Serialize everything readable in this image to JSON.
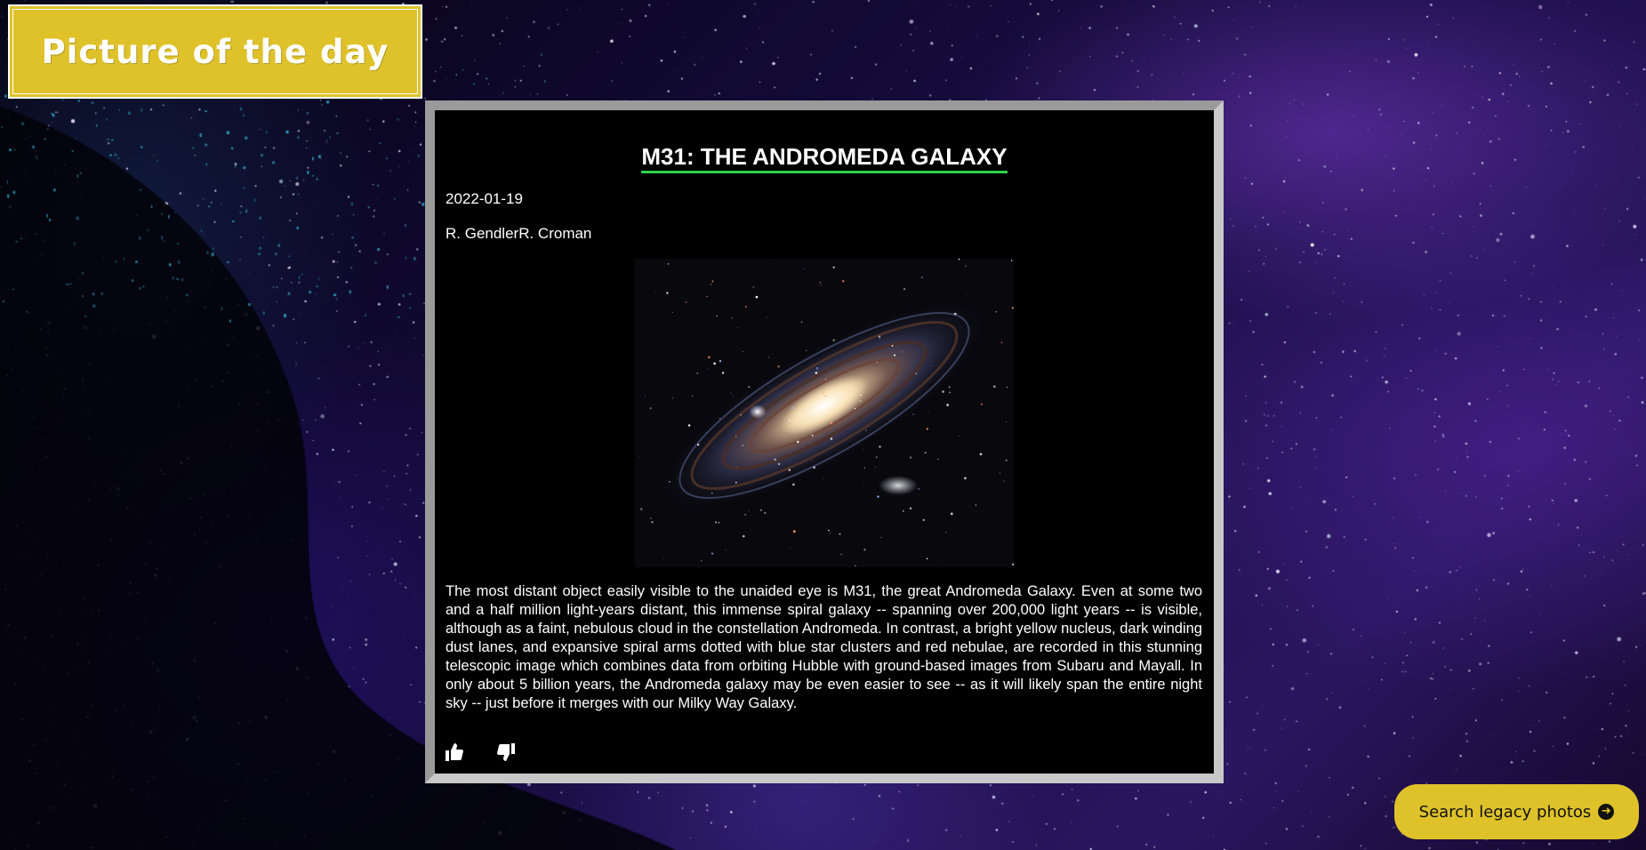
{
  "header": {
    "title": "Picture of the day"
  },
  "apod": {
    "title": "M31: THE ANDROMEDA GALAXY",
    "date": "2022-01-19",
    "copyright": "R. GendlerR. Croman",
    "image_alt": "M31: The Andromeda Galaxy",
    "explanation": "The most distant object easily visible to the unaided eye is M31, the great Andromeda Galaxy. Even at some two and a half million light-years distant, this immense spiral galaxy -- spanning over 200,000 light years -- is visible, although as a faint, nebulous cloud in the constellation Andromeda. In contrast, a bright yellow nucleus, dark winding dust lanes, and expansive spiral arms dotted with blue star clusters and red nebulae, are recorded in this stunning telescopic image which combines data from orbiting Hubble with ground-based images from Subaru and Mayall. In only about 5 billion years, the Andromeda galaxy may be even easier to see -- as it will likely span the entire night sky -- just before it merges with our Milky Way Galaxy."
  },
  "actions": {
    "like_icon": "thumbs-up-icon",
    "dislike_icon": "thumbs-down-icon"
  },
  "footer": {
    "search_label": "Search legacy photos",
    "search_icon": "arrow-circle-right-icon"
  },
  "colors": {
    "accent": "#dfc22a",
    "title_underline": "#2bd24a",
    "card_background": "#000000"
  }
}
